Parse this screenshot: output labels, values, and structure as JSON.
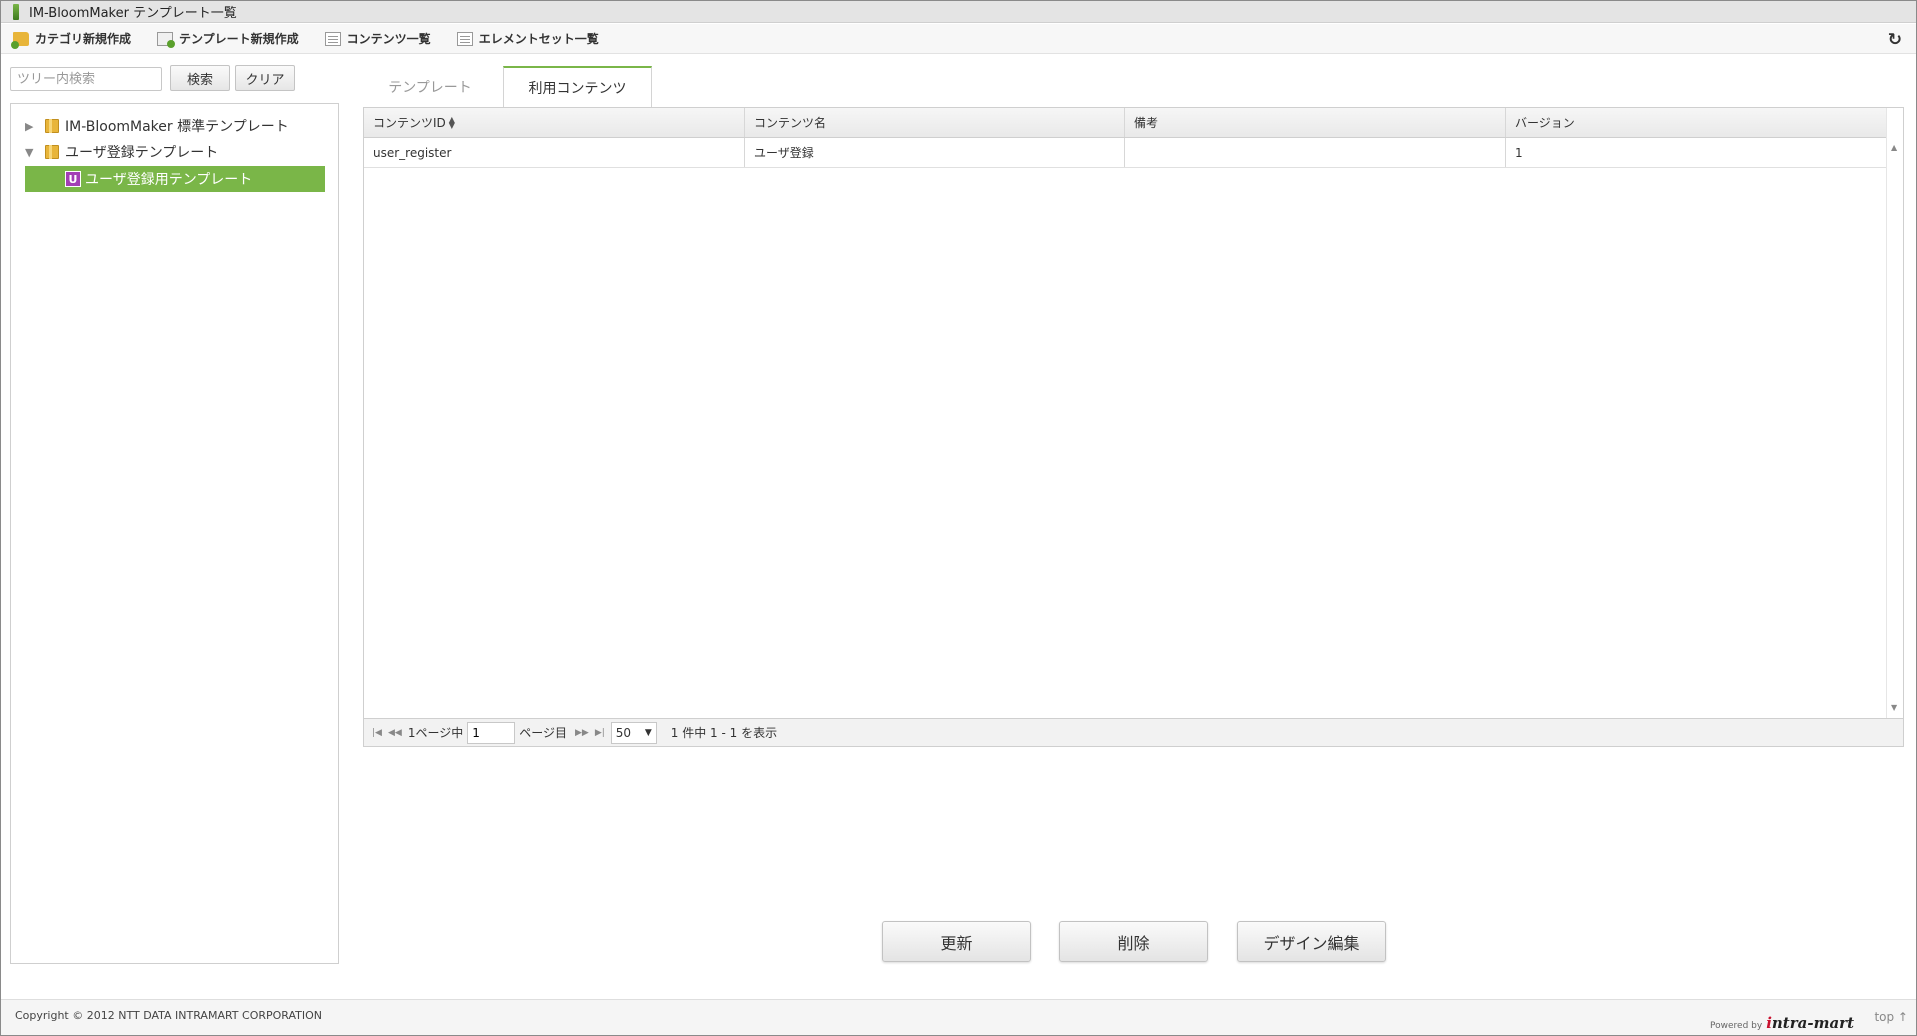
{
  "window": {
    "title": "IM-BloomMaker テンプレート一覧"
  },
  "toolbar": {
    "items": [
      {
        "label": "カテゴリ新規作成",
        "icon": "folder-add-icon"
      },
      {
        "label": "テンプレート新規作成",
        "icon": "document-add-icon"
      },
      {
        "label": "コンテンツ一覧",
        "icon": "list-icon"
      },
      {
        "label": "エレメントセット一覧",
        "icon": "list-icon"
      }
    ],
    "refresh_icon": "refresh-icon"
  },
  "tree": {
    "search_placeholder": "ツリー内検索",
    "search_button": "検索",
    "clear_button": "クリア",
    "nodes": [
      {
        "label": "IM-BloomMaker 標準テンプレート",
        "expanded": false
      },
      {
        "label": "ユーザ登録テンプレート",
        "expanded": true
      },
      {
        "label": "ユーザ登録用テンプレート",
        "badge": "U",
        "selected": true
      }
    ],
    "toggle_collapsed": "▶",
    "toggle_expanded": "▼"
  },
  "tabs": [
    {
      "label": "テンプレート",
      "active": false
    },
    {
      "label": "利用コンテンツ",
      "active": true
    }
  ],
  "grid": {
    "columns": [
      "コンテンツID",
      "コンテンツ名",
      "備考",
      "バージョン"
    ],
    "rows": [
      [
        "user_register",
        "ユーザ登録",
        "",
        "1"
      ]
    ]
  },
  "pager": {
    "first": "|◀",
    "prev": "◀◀",
    "next": "▶▶",
    "last": "▶|",
    "total_pages_label": "1ページ中",
    "current_page": "1",
    "page_suffix": "ページ目",
    "page_size": "50",
    "summary": "1 件中 1 - 1 を表示"
  },
  "actions": {
    "update": "更新",
    "delete": "削除",
    "design_edit": "デザイン編集"
  },
  "footer": {
    "copyright": "Copyright © 2012 NTT DATA INTRAMART CORPORATION",
    "powered_by": "Powered by",
    "brand": "ntra-mart",
    "brand_initial": "i",
    "top_link": "top ↑"
  },
  "colors": {
    "accent_green": "#7ab648",
    "badge_purple": "#a23fb5"
  }
}
